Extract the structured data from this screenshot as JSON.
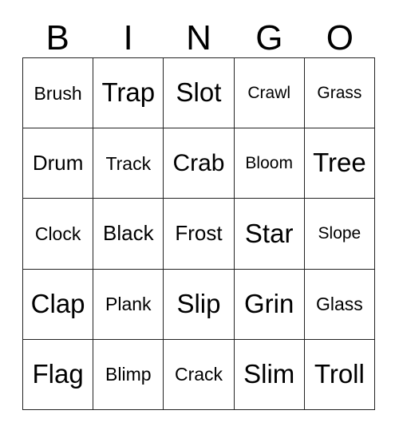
{
  "card": {
    "type": "bingo-card",
    "columns": 5,
    "rows": 5,
    "header_letters": [
      "B",
      "I",
      "N",
      "G",
      "O"
    ],
    "colors": {
      "background": "#ffffff",
      "text": "#000000",
      "grid_line": "#222222"
    },
    "grid": [
      [
        {
          "label": "Brush",
          "size": "sm"
        },
        {
          "label": "Trap",
          "size": "xl"
        },
        {
          "label": "Slot",
          "size": "xl"
        },
        {
          "label": "Crawl",
          "size": "xs"
        },
        {
          "label": "Grass",
          "size": "xs"
        }
      ],
      [
        {
          "label": "Drum",
          "size": "md"
        },
        {
          "label": "Track",
          "size": "sm"
        },
        {
          "label": "Crab",
          "size": "lg"
        },
        {
          "label": "Bloom",
          "size": "xs"
        },
        {
          "label": "Tree",
          "size": "xl"
        }
      ],
      [
        {
          "label": "Clock",
          "size": "sm"
        },
        {
          "label": "Black",
          "size": "md"
        },
        {
          "label": "Frost",
          "size": "md"
        },
        {
          "label": "Star",
          "size": "xl"
        },
        {
          "label": "Slope",
          "size": "xs"
        }
      ],
      [
        {
          "label": "Clap",
          "size": "xl"
        },
        {
          "label": "Plank",
          "size": "sm"
        },
        {
          "label": "Slip",
          "size": "xl"
        },
        {
          "label": "Grin",
          "size": "xl"
        },
        {
          "label": "Glass",
          "size": "sm"
        }
      ],
      [
        {
          "label": "Flag",
          "size": "xl"
        },
        {
          "label": "Blimp",
          "size": "sm"
        },
        {
          "label": "Crack",
          "size": "sm"
        },
        {
          "label": "Slim",
          "size": "xl"
        },
        {
          "label": "Troll",
          "size": "xl"
        }
      ]
    ]
  }
}
